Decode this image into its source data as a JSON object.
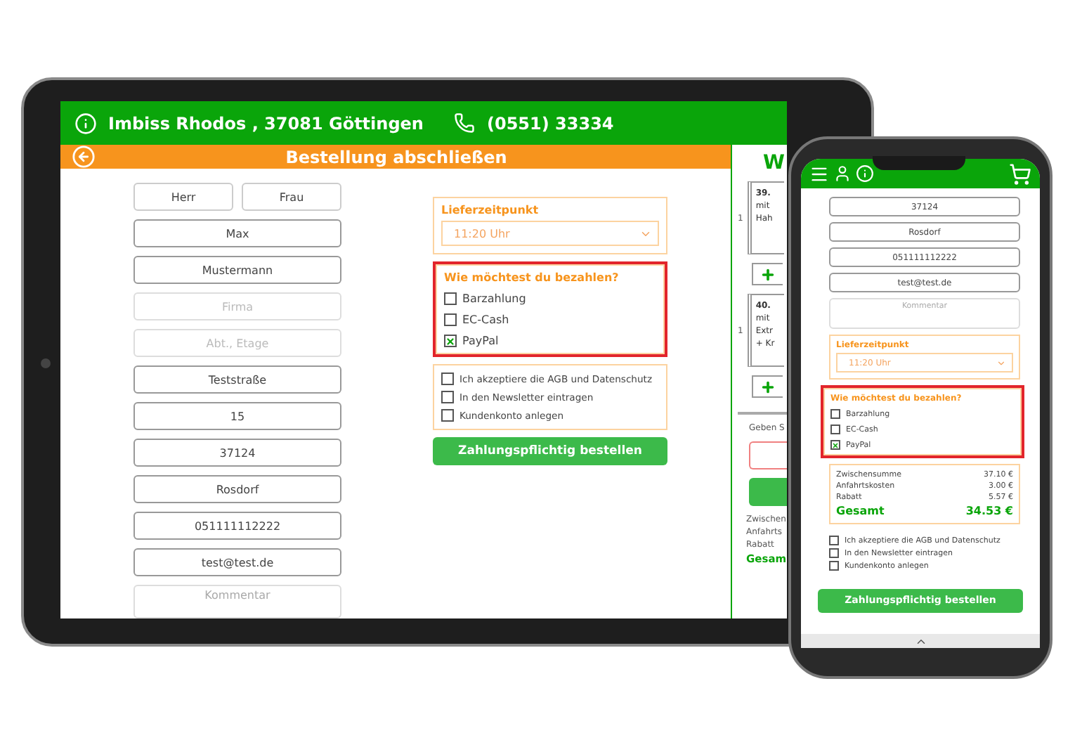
{
  "tablet": {
    "header": {
      "info": "Imbiss Rhodos , 37081 Göttingen",
      "phone": "(0551) 33334"
    },
    "title": "Bestellung abschließen",
    "salutations": [
      {
        "label": "Herr",
        "selected": false
      },
      {
        "label": "Frau",
        "selected": false
      }
    ],
    "fields": [
      {
        "value": "Max"
      },
      {
        "value": "Mustermann"
      },
      {
        "placeholder": "Firma"
      },
      {
        "placeholder": "Abt., Etage"
      },
      {
        "value": "Teststraße"
      },
      {
        "value": "15"
      },
      {
        "value": "37124"
      },
      {
        "value": "Rosdorf"
      },
      {
        "value": "051111112222"
      },
      {
        "value": "test@test.de"
      },
      {
        "placeholder": "Kommentar"
      }
    ],
    "delivery": {
      "label": "Lieferzeitpunkt",
      "value": "11:20 Uhr"
    },
    "payment": {
      "title": "Wie möchtest du bezahlen?",
      "options": [
        {
          "label": "Barzahlung",
          "checked": false
        },
        {
          "label": "EC-Cash",
          "checked": false
        },
        {
          "label": "PayPal",
          "checked": true
        }
      ]
    },
    "consents": [
      {
        "label": "Ich akzeptiere die AGB und Datenschutz",
        "checked": false
      },
      {
        "label": "In den Newsletter eintragen",
        "checked": false
      },
      {
        "label": "Kundenkonto anlegen",
        "checked": false
      }
    ],
    "submit": "Zahlungspflichtig bestellen",
    "cart": {
      "heading": "W",
      "items": [
        {
          "qty": "1",
          "lines": [
            "39.",
            "mit",
            "Hah"
          ]
        },
        {
          "qty": "1",
          "lines": [
            "40.",
            "mit",
            "Extr",
            "+ Kr"
          ]
        }
      ],
      "hint": "Geben S",
      "totals": [
        "Zwischen",
        "Anfahrts",
        "Rabatt"
      ],
      "total": "Gesam"
    }
  },
  "phone": {
    "fields": [
      {
        "value": "37124"
      },
      {
        "value": "Rosdorf"
      },
      {
        "value": "051111112222"
      },
      {
        "value": "test@test.de"
      }
    ],
    "comment": {
      "placeholder": "Kommentar"
    },
    "delivery": {
      "label": "Lieferzeitpunkt",
      "value": "11:20 Uhr"
    },
    "payment": {
      "title": "Wie möchtest du bezahlen?",
      "options": [
        {
          "label": "Barzahlung",
          "checked": false
        },
        {
          "label": "EC-Cash",
          "checked": false
        },
        {
          "label": "PayPal",
          "checked": true
        }
      ]
    },
    "summary": [
      {
        "label": "Zwischensumme",
        "amount": "37.10 €"
      },
      {
        "label": "Anfahrtskosten",
        "amount": "3.00 €"
      },
      {
        "label": "Rabatt",
        "amount": "5.57 €"
      }
    ],
    "total": {
      "label": "Gesamt",
      "amount": "34.53 €"
    },
    "consents": [
      {
        "label": "Ich akzeptiere die AGB und Datenschutz",
        "checked": false
      },
      {
        "label": "In den Newsletter eintragen",
        "checked": false
      },
      {
        "label": "Kundenkonto anlegen",
        "checked": false
      }
    ],
    "submit": "Zahlungspflichtig bestellen"
  }
}
